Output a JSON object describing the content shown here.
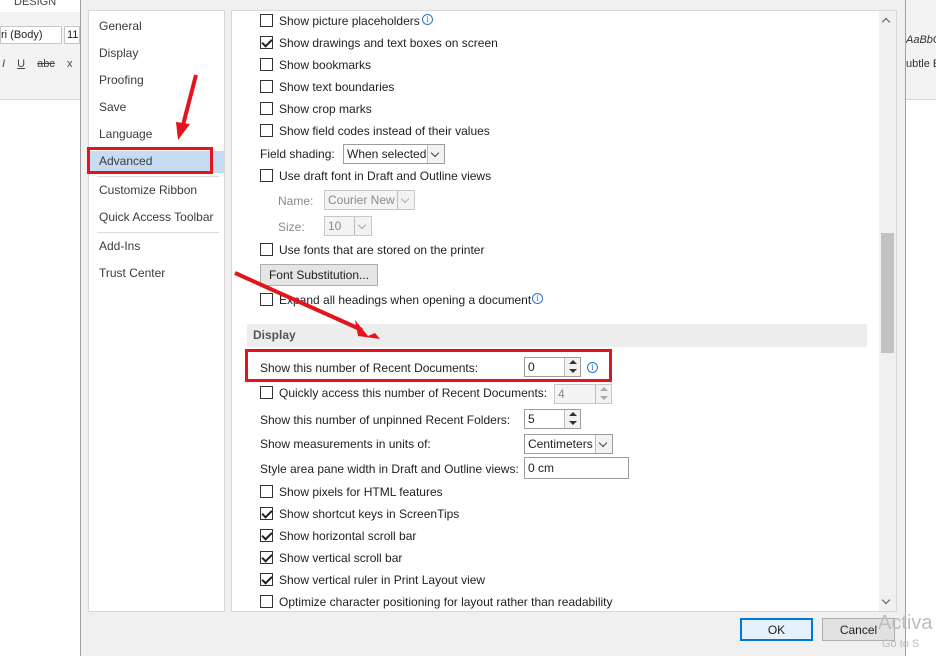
{
  "background": {
    "ribbon_tab": "DESIGN",
    "font_name": "ri (Body)",
    "font_size": "11",
    "format_icons": [
      "I",
      "U",
      "abc",
      "x"
    ],
    "style_preview_1": "AaBbC",
    "style_preview_2": "ubtle E",
    "watermark_1": "Activa",
    "watermark_2": "Go to S"
  },
  "nav": {
    "items": [
      {
        "label": "General"
      },
      {
        "label": "Display"
      },
      {
        "label": "Proofing"
      },
      {
        "label": "Save"
      },
      {
        "label": "Language"
      },
      {
        "label": "Advanced",
        "selected": true
      },
      {
        "label": "Customize Ribbon"
      },
      {
        "label": "Quick Access Toolbar"
      },
      {
        "label": "Add-Ins"
      },
      {
        "label": "Trust Center"
      }
    ]
  },
  "content": {
    "show_picture_placeholders": {
      "label": "Show picture placeholders",
      "checked": false
    },
    "show_drawings": {
      "label": "Show drawings and text boxes on screen",
      "checked": true
    },
    "show_bookmarks": {
      "label": "Show bookmarks",
      "checked": false
    },
    "show_text_boundaries": {
      "label": "Show text boundaries",
      "checked": false
    },
    "show_crop_marks": {
      "label": "Show crop marks",
      "checked": false
    },
    "show_field_codes": {
      "label": "Show field codes instead of their values",
      "checked": false
    },
    "field_shading": {
      "label": "Field shading:",
      "value": "When selected"
    },
    "use_draft_font": {
      "label": "Use draft font in Draft and Outline views",
      "checked": false
    },
    "draft_name": {
      "label": "Name:",
      "value": "Courier New"
    },
    "draft_size": {
      "label": "Size:",
      "value": "10"
    },
    "use_printer_fonts": {
      "label": "Use fonts that are stored on the printer",
      "checked": false
    },
    "font_substitution_button": "Font Substitution...",
    "expand_headings": {
      "label": "Expand all headings when opening a document",
      "checked": false
    },
    "display_section_title": "Display",
    "recent_docs": {
      "label": "Show this number of Recent Documents:",
      "value": "0"
    },
    "quick_access_recent": {
      "label": "Quickly access this number of Recent Documents:",
      "value": "4",
      "checked": false
    },
    "unpinned_folders": {
      "label": "Show this number of unpinned Recent Folders:",
      "value": "5"
    },
    "measurement_units": {
      "label": "Show measurements in units of:",
      "value": "Centimeters"
    },
    "style_area_width": {
      "label": "Style area pane width in Draft and Outline views:",
      "value": "0 cm"
    },
    "show_pixels_html": {
      "label": "Show pixels for HTML features",
      "checked": false
    },
    "show_shortcut_keys": {
      "label": "Show shortcut keys in ScreenTips",
      "checked": true
    },
    "show_horizontal_scroll": {
      "label": "Show horizontal scroll bar",
      "checked": true
    },
    "show_vertical_scroll": {
      "label": "Show vertical scroll bar",
      "checked": true
    },
    "show_vertical_ruler": {
      "label": "Show vertical ruler in Print Layout view",
      "checked": true
    },
    "optimize_char_positioning": {
      "label": "Optimize character positioning for layout rather than readability",
      "checked": false
    }
  },
  "footer": {
    "ok_label": "OK",
    "cancel_label": "Cancel"
  },
  "annotation_color": "#e3141b"
}
